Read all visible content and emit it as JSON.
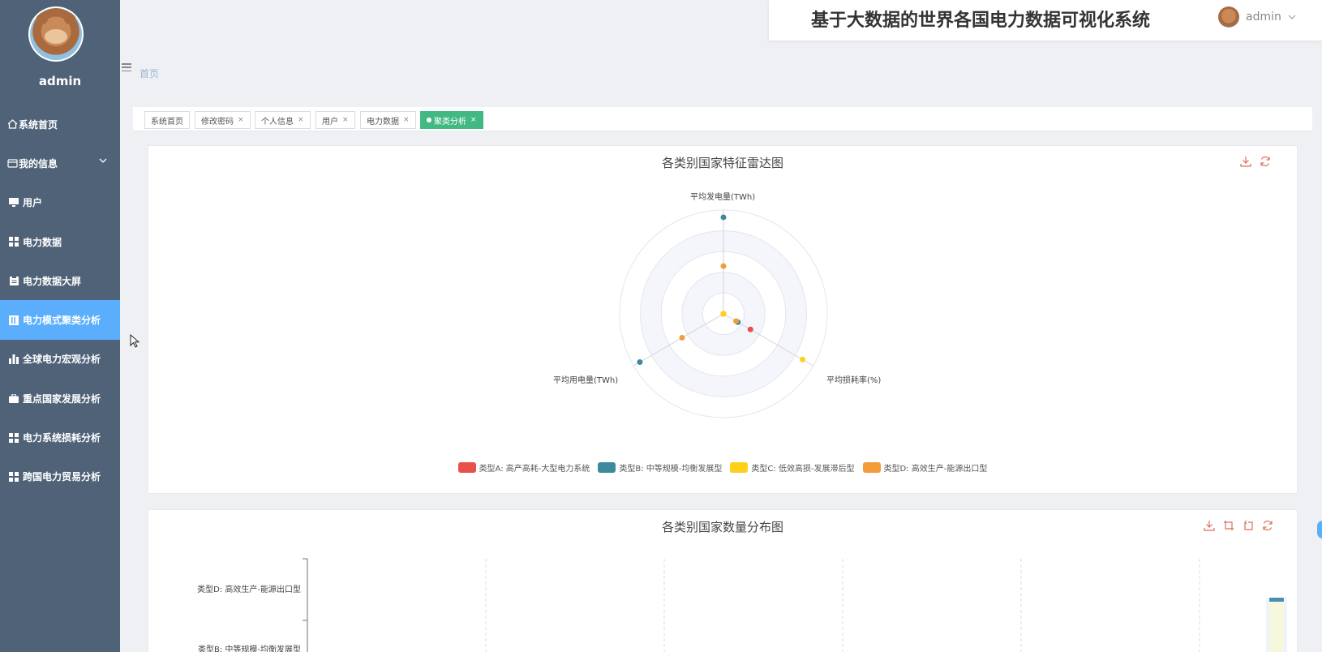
{
  "sidebar": {
    "username": "admin",
    "items": [
      {
        "label": "系统首页",
        "icon": "home-icon",
        "active": false
      },
      {
        "label": "我的信息",
        "icon": "id-card-icon",
        "active": false,
        "has_submenu": true
      },
      {
        "label": "用户",
        "icon": "monitor-icon",
        "active": false
      },
      {
        "label": "电力数据",
        "icon": "grid-icon",
        "active": false
      },
      {
        "label": "电力数据大屏",
        "icon": "clipboard-icon",
        "active": false
      },
      {
        "label": "电力模式聚类分析",
        "icon": "book-icon",
        "active": true
      },
      {
        "label": "全球电力宏观分析",
        "icon": "bar-chart-icon",
        "active": false
      },
      {
        "label": "重点国家发展分析",
        "icon": "briefcase-icon",
        "active": false
      },
      {
        "label": "电力系统损耗分析",
        "icon": "grid-icon",
        "active": false
      },
      {
        "label": "跨国电力贸易分析",
        "icon": "grid-icon",
        "active": false
      }
    ],
    "active_color": "#5aaefc",
    "background_color": "#4f6278"
  },
  "header": {
    "title": "基于大数据的世界各国电力数据可视化系统",
    "user": "admin"
  },
  "breadcrumb": {
    "current": "首页"
  },
  "tabs": [
    {
      "label": "系统首页",
      "closable": false,
      "active": false
    },
    {
      "label": "修改密码",
      "closable": true,
      "active": false
    },
    {
      "label": "个人信息",
      "closable": true,
      "active": false
    },
    {
      "label": "用户",
      "closable": true,
      "active": false
    },
    {
      "label": "电力数据",
      "closable": true,
      "active": false
    },
    {
      "label": "聚类分析",
      "closable": true,
      "active": true
    }
  ],
  "chart_data": [
    {
      "type": "radar",
      "title": "各类别国家特征雷达图",
      "indicators": [
        "平均发电量(TWh)",
        "平均损耗率(%)",
        "平均用电量(TWh)"
      ],
      "series": [
        {
          "name": "类型A: 高产高耗-大型电力系统",
          "color": "#e8504a",
          "values": [
            0.0,
            0.3,
            0.0
          ]
        },
        {
          "name": "类型B: 中等规模-均衡发展型",
          "color": "#3e8a9c",
          "values": [
            0.93,
            0.16,
            0.93
          ]
        },
        {
          "name": "类型C: 低效高损-发展滞后型",
          "color": "#fdd01c",
          "values": [
            0.0,
            0.88,
            0.0
          ]
        },
        {
          "name": "类型D: 高效生产-能源出口型",
          "color": "#f49b3a",
          "values": [
            0.46,
            0.14,
            0.46
          ]
        }
      ]
    },
    {
      "type": "bar",
      "title": "各类别国家数量分布图",
      "categories": [
        "类型D: 高效生产-能源出口型",
        "类型B: 中等规模-均衡发展型"
      ],
      "orientation": "horizontal",
      "grid": true
    }
  ]
}
